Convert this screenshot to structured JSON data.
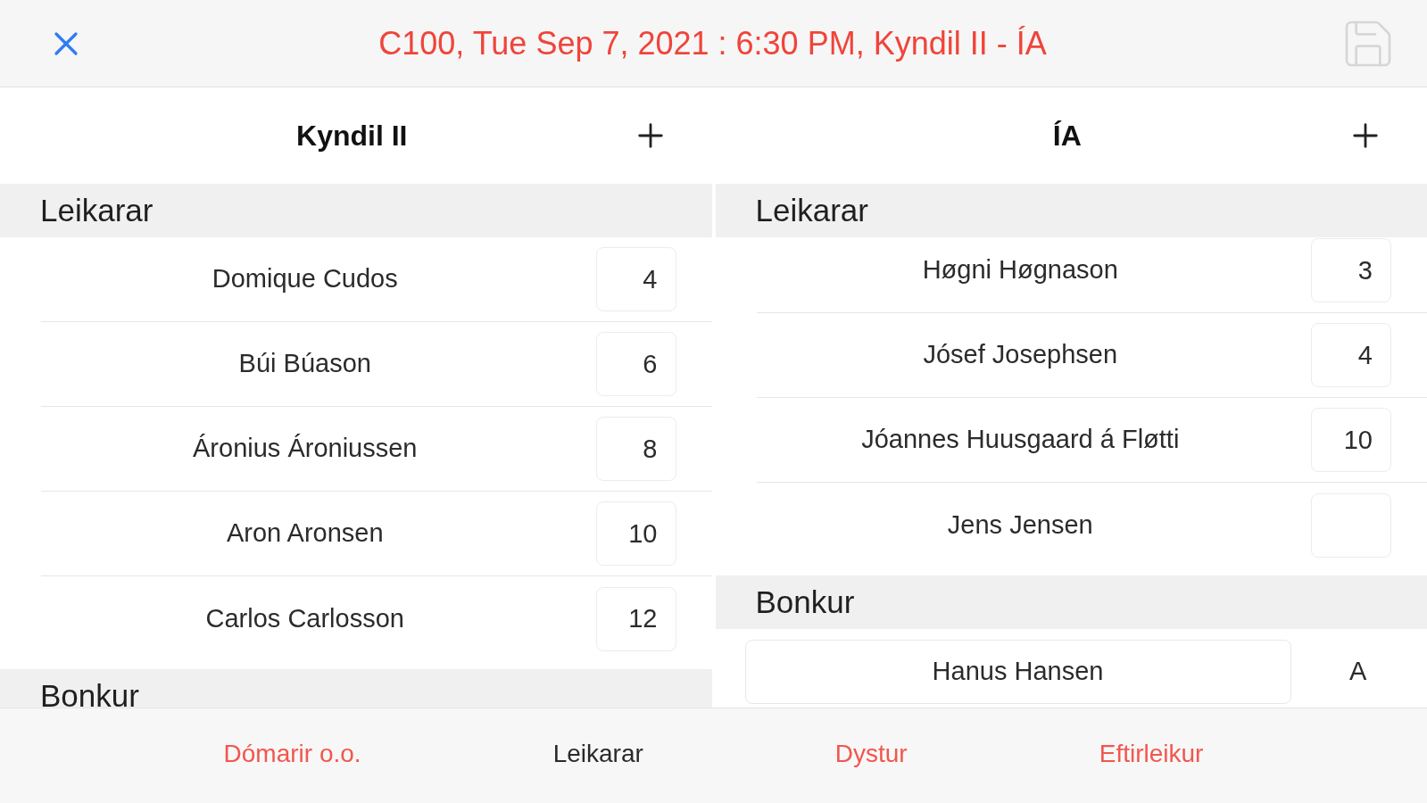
{
  "header": {
    "title": "C100, Tue Sep 7, 2021 : 6:30 PM, Kyndil II - ÍA",
    "save": {
      "disabled": true
    }
  },
  "teams": [
    {
      "name": "Kyndil II",
      "sections": [
        {
          "kind": "lineup",
          "title": "Leikarar",
          "players": [
            {
              "name": "Domique Cudos",
              "number": "4"
            },
            {
              "name": "Búi Búason",
              "number": "6"
            },
            {
              "name": "Áronius Ároniussen",
              "number": "8"
            },
            {
              "name": "Aron Aronsen",
              "number": "10"
            },
            {
              "name": "Carlos Carlosson",
              "number": "12"
            }
          ]
        },
        {
          "kind": "bench",
          "title": "Bonkur"
        }
      ]
    },
    {
      "name": "ÍA",
      "sections": [
        {
          "kind": "lineup",
          "title": "Leikarar",
          "players": [
            {
              "name": "Høgni Høgnason",
              "number": "3"
            },
            {
              "name": "Jósef Josephsen",
              "number": "4"
            },
            {
              "name": "Jóannes Huusgaard á Fløtti",
              "number": "10"
            },
            {
              "name": "Jens Jensen"
            }
          ]
        },
        {
          "kind": "bench",
          "title": "Bonkur",
          "players": [
            {
              "name": "Hanus Hansen",
              "tag": "A"
            }
          ]
        }
      ]
    }
  ],
  "tabs": [
    {
      "label": "Dómarir o.o.",
      "selected": false
    },
    {
      "label": "Leikarar",
      "selected": true
    },
    {
      "label": "Dystur",
      "selected": false
    },
    {
      "label": "Eftirleikur",
      "selected": false
    }
  ]
}
